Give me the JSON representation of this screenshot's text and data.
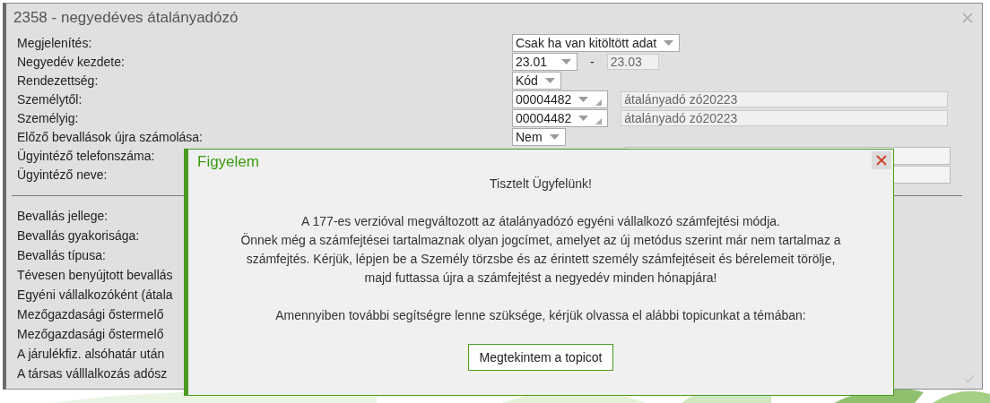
{
  "window": {
    "title": "2358 - negyedéves átalányadózó"
  },
  "form": {
    "rows": [
      {
        "kind": "select",
        "label": "Megjelenítés:",
        "value": "Csak ha van kitöltött adat"
      },
      {
        "kind": "range",
        "label": "Negyedév kezdete:",
        "value": "23.01",
        "separator": "-",
        "end": "23.03"
      },
      {
        "kind": "select",
        "label": "Rendezettség:",
        "value": "Kód"
      },
      {
        "kind": "person",
        "label": "Személytől:",
        "value": "00004482",
        "name": "átalányadó zó20223"
      },
      {
        "kind": "person",
        "label": "Személyig:",
        "value": "00004482",
        "name": "átalányadó zó20223"
      },
      {
        "kind": "select",
        "label": "Előző bevallások újra számolása:",
        "value": "Nem"
      },
      {
        "kind": "text",
        "label": "Ügyintéző telefonszáma:"
      },
      {
        "kind": "text",
        "label": "Ügyintéző neve:"
      }
    ],
    "labels": [
      "Bevallás jellege:",
      "Bevallás gyakorisága:",
      "Bevallás típusa:",
      "Tévesen benyújtott bevallás",
      "Egyéni vállalkozóként (átala",
      "Mezőgazdasági őstermelő",
      "Mezőgazdasági őstermelő",
      "A járulékfiz. alsóhatár után",
      "A társas válllalkozás adósz"
    ]
  },
  "dialog": {
    "title": "Figyelem",
    "paragraphs": [
      [
        "Tisztelt Ügyfelünk!"
      ],
      [
        "A 177-es verzióval megváltozott az átalányadózó egyéni vállalkozó számfejtési módja.",
        "Önnek még a számfejtései tartalmaznak olyan jogcímet, amelyet az új metódus szerint már nem tartalmaz a számfejtés. Kérjük, lépjen be a Személy törzsbe és az érintett személy számfejtéseit és bérelemeit törölje, majd futtassa újra a számfejtést a negyedév minden hónapjára!"
      ],
      [
        "Amennyiben további segítségre lenne szüksége, kérjük olvassa el alábbi topicunkat a témában:"
      ]
    ],
    "button": "Megtekintem a topicot"
  }
}
